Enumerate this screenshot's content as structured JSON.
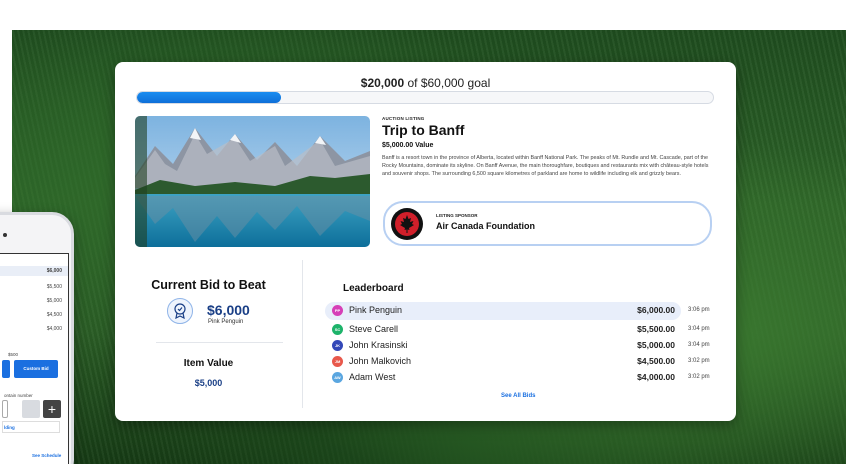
{
  "colors": {
    "accent": "#1a6fe0",
    "navy": "#1a3f86",
    "progress": "#1a8cf0"
  },
  "goal": {
    "raised": "$20,000",
    "rest": " of $60,000 goal",
    "progress": 0.25
  },
  "listing": {
    "eyebrow": "AUCTION LISTING",
    "title": "Trip to Banff",
    "value": "$5,000.00 Value",
    "description": "Banff is a resort town in the province of Alberta, located within Banff National Park. The peaks of Mt. Rundle and Mt. Cascade, part of the Rocky Mountains, dominate its skyline. On Banff Avenue, the main thoroughfare, boutiques and restaurants mix with château-style hotels and souvenir shops. The surrounding 6,500 square kilometres of parkland are home to wildlife including elk and grizzly bears.",
    "sponsor": {
      "eyebrow": "LISTING SPONSOR",
      "name": "Air Canada Foundation",
      "logo_icon": "maple-leaf-icon"
    }
  },
  "current_bid": {
    "title": "Current Bid to Beat",
    "amount": "$6,000",
    "bidder": "Pink Penguin",
    "icon": "bidder-badge-icon"
  },
  "item_value": {
    "title": "Item Value",
    "amount": "$5,000"
  },
  "leaderboard": {
    "title": "Leaderboard",
    "see_all": "See All Bids",
    "rows": [
      {
        "initials": "PP",
        "name": "Pink Penguin",
        "amount": "$6,000.00",
        "time": "3:06 pm",
        "color": "#d63fb7"
      },
      {
        "initials": "SC",
        "name": "Steve Carell",
        "amount": "$5,500.00",
        "time": "3:04 pm",
        "color": "#1db36a"
      },
      {
        "initials": "JK",
        "name": "John Krasinski",
        "amount": "$5,000.00",
        "time": "3:04 pm",
        "color": "#3348b8"
      },
      {
        "initials": "JM",
        "name": "John Malkovich",
        "amount": "$4,500.00",
        "time": "3:02 pm",
        "color": "#e8584b"
      },
      {
        "initials": "AW",
        "name": "Adam West",
        "amount": "$4,000.00",
        "time": "3:02 pm",
        "color": "#5aa6e0"
      }
    ]
  },
  "phone": {
    "bids": [
      "$6,000",
      "$5,500",
      "$5,000",
      "$4,500",
      "$4,000"
    ],
    "label_small": "$500",
    "custom_bid": "Custom Bid",
    "contain_hint": "ontain number",
    "bidding_link": "lding",
    "see_schedule": "See Schedule"
  }
}
